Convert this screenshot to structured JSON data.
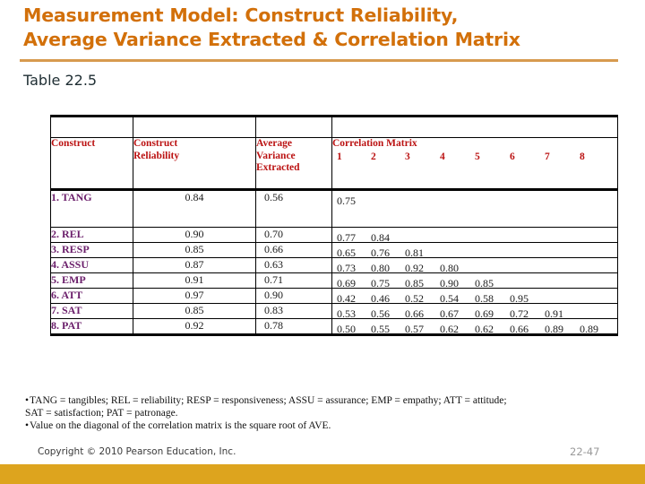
{
  "title": {
    "line1": "Measurement Model: Construct Reliability,",
    "line2": "Average Variance Extracted & Correlation Matrix",
    "color": "#D2700A",
    "rule_color": "#D79A4E"
  },
  "caption": "Table 22.5",
  "table": {
    "headers": {
      "construct": "Construct",
      "reliability_l1": "Construct",
      "reliability_l2": "Reliability",
      "ave_l1": "Average",
      "ave_l2": "Variance",
      "ave_l3": "Extracted",
      "correlation": "Correlation Matrix",
      "corr_indices": [
        "1",
        "2",
        "3",
        "4",
        "5",
        "6",
        "7",
        "8"
      ]
    },
    "header_color": "#BB1212",
    "row_label_color": "#6B1F6B",
    "rows": [
      {
        "label": "1. TANG",
        "reliability": "0.84",
        "ave": "0.56",
        "correlations": [
          "0.75"
        ]
      },
      {
        "label": "2. REL",
        "reliability": "0.90",
        "ave": "0.70",
        "correlations": [
          "0.77",
          "0.84"
        ]
      },
      {
        "label": "3. RESP",
        "reliability": "0.85",
        "ave": "0.66",
        "correlations": [
          "0.65",
          "0.76",
          "0.81"
        ]
      },
      {
        "label": "4. ASSU",
        "reliability": "0.87",
        "ave": "0.63",
        "correlations": [
          "0.73",
          "0.80",
          "0.92",
          "0.80"
        ]
      },
      {
        "label": "5. EMP",
        "reliability": "0.91",
        "ave": "0.71",
        "correlations": [
          "0.69",
          "0.75",
          "0.85",
          "0.90",
          "0.85"
        ]
      },
      {
        "label": "6. ATT",
        "reliability": "0.97",
        "ave": "0.90",
        "correlations": [
          "0.42",
          "0.46",
          "0.52",
          "0.54",
          "0.58",
          "0.95"
        ]
      },
      {
        "label": "7. SAT",
        "reliability": "0.85",
        "ave": "0.83",
        "correlations": [
          "0.53",
          "0.56",
          "0.66",
          "0.67",
          "0.69",
          "0.72",
          "0.91"
        ]
      },
      {
        "label": "8. PAT",
        "reliability": "0.92",
        "ave": "0.78",
        "correlations": [
          "0.50",
          "0.55",
          "0.57",
          "0.62",
          "0.62",
          "0.66",
          "0.89",
          "0.89"
        ]
      }
    ]
  },
  "notes": {
    "line1": "TANG = tangibles; REL = reliability; RESP = responsiveness; ASSU = assurance; EMP = empathy; ATT = attitude;",
    "line2": "SAT = satisfaction; PAT = patronage.",
    "line3": "Value on the diagonal of the correlation matrix is the square root of AVE.",
    "bullet": "•"
  },
  "footer": {
    "copyright": "Copyright © 2010 Pearson Education, Inc.",
    "page_number": "22-47",
    "bar_color": "#DDA41E"
  },
  "chart_data": {
    "type": "table",
    "title": "Measurement Model: Construct Reliability, Average Variance Extracted & Correlation Matrix",
    "columns": [
      "Construct",
      "Construct Reliability",
      "Average Variance Extracted",
      "1",
      "2",
      "3",
      "4",
      "5",
      "6",
      "7",
      "8"
    ],
    "rows": [
      [
        "1. TANG",
        0.84,
        0.56,
        0.75,
        null,
        null,
        null,
        null,
        null,
        null,
        null
      ],
      [
        "2. REL",
        0.9,
        0.7,
        0.77,
        0.84,
        null,
        null,
        null,
        null,
        null,
        null
      ],
      [
        "3. RESP",
        0.85,
        0.66,
        0.65,
        0.76,
        0.81,
        null,
        null,
        null,
        null,
        null
      ],
      [
        "4. ASSU",
        0.87,
        0.63,
        0.73,
        0.8,
        0.92,
        0.8,
        null,
        null,
        null,
        null
      ],
      [
        "5. EMP",
        0.91,
        0.71,
        0.69,
        0.75,
        0.85,
        0.9,
        0.85,
        null,
        null,
        null
      ],
      [
        "6. ATT",
        0.97,
        0.9,
        0.42,
        0.46,
        0.52,
        0.54,
        0.58,
        0.95,
        null,
        null
      ],
      [
        "7. SAT",
        0.85,
        0.83,
        0.53,
        0.56,
        0.66,
        0.67,
        0.69,
        0.72,
        0.91,
        null
      ],
      [
        "8. PAT",
        0.92,
        0.78,
        0.5,
        0.55,
        0.57,
        0.62,
        0.62,
        0.66,
        0.89,
        0.89
      ]
    ]
  }
}
